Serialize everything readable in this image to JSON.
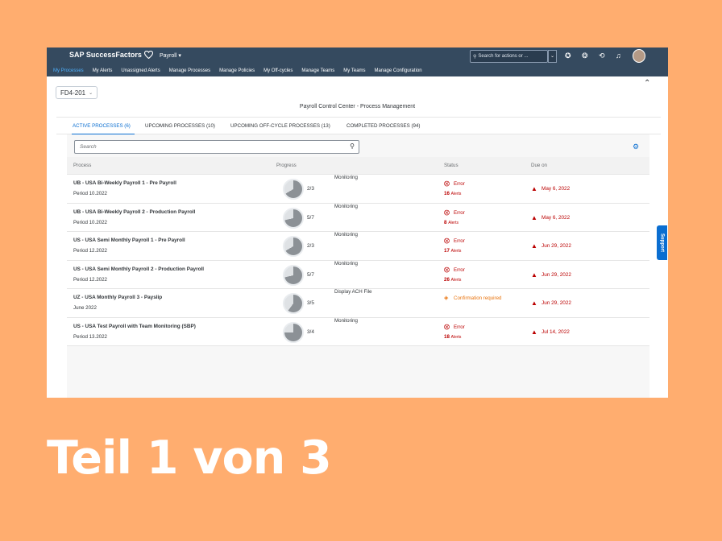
{
  "shell": {
    "brand": "SAP SuccessFactors",
    "app": "Payroll ▾",
    "search_placeholder": "Search for actions or ..."
  },
  "nav": [
    "My Processes",
    "My Alerts",
    "Unassigned Alerts",
    "Manage Processes",
    "Manage Policies",
    "My Off-cycles",
    "Manage Teams",
    "My Teams",
    "Manage Configuration"
  ],
  "scope": {
    "value": "FD4-201"
  },
  "page_title": "Payroll Control Center - Process Management",
  "tabs": [
    "ACTIVE PROCESSES (6)",
    "UPCOMING PROCESSES (10)",
    "UPCOMING OFF-CYCLE PROCESSES (13)",
    "COMPLETED PROCESSES (94)"
  ],
  "search": {
    "placeholder": "Search"
  },
  "table": {
    "headers": {
      "process": "Process",
      "progress": "Progress",
      "status": "Status",
      "due": "Due on"
    },
    "rows": [
      {
        "name": "UB - USA Bi-Weekly Payroll 1 - Pre Payroll",
        "period": "Period 10.2022",
        "progress": "2/3",
        "fraction": 0.667,
        "step": "Monitoring",
        "status": "Error",
        "count": "16",
        "count_label": "Alerts",
        "due": "May 6, 2022"
      },
      {
        "name": "UB - USA Bi-Weekly Payroll 2 - Production Payroll",
        "period": "Period 10.2022",
        "progress": "5/7",
        "fraction": 0.714,
        "step": "Monitoring",
        "status": "Error",
        "count": "8",
        "count_label": "Alerts",
        "due": "May 6, 2022"
      },
      {
        "name": "US - USA Semi Monthly Payroll 1 - Pre Payroll",
        "period": "Period 12.2022",
        "progress": "2/3",
        "fraction": 0.667,
        "step": "Monitoring",
        "status": "Error",
        "count": "17",
        "count_label": "Alerts",
        "due": "Jun 29, 2022"
      },
      {
        "name": "US - USA Semi Monthly Payroll 2 - Production Payroll",
        "period": "Period 12.2022",
        "progress": "5/7",
        "fraction": 0.714,
        "step": "Monitoring",
        "status": "Error",
        "count": "26",
        "count_label": "Alerts",
        "due": "Jun 29, 2022"
      },
      {
        "name": "UZ - USA Monthly Payroll 3 - Payslip",
        "period": "June 2022",
        "progress": "3/5",
        "fraction": 0.6,
        "step": "Display ACH File",
        "status": "Confirmation required",
        "count": "",
        "count_label": "",
        "due": "Jun 29, 2022"
      },
      {
        "name": "US - USA Test Payroll with Team Monitoring (SBP)",
        "period": "Period 13.2022",
        "progress": "3/4",
        "fraction": 0.75,
        "step": "Monitoring",
        "status": "Error",
        "count": "18",
        "count_label": "Alerts",
        "due": "Jul 14, 2022"
      }
    ]
  },
  "support_label": "Support",
  "caption": "Teil 1 von 3",
  "colors": {
    "error": "#bb0000",
    "warning": "#e9730c",
    "accent": "#0a6ed1",
    "shell": "#354a5f",
    "background": "#FFAD6F"
  }
}
